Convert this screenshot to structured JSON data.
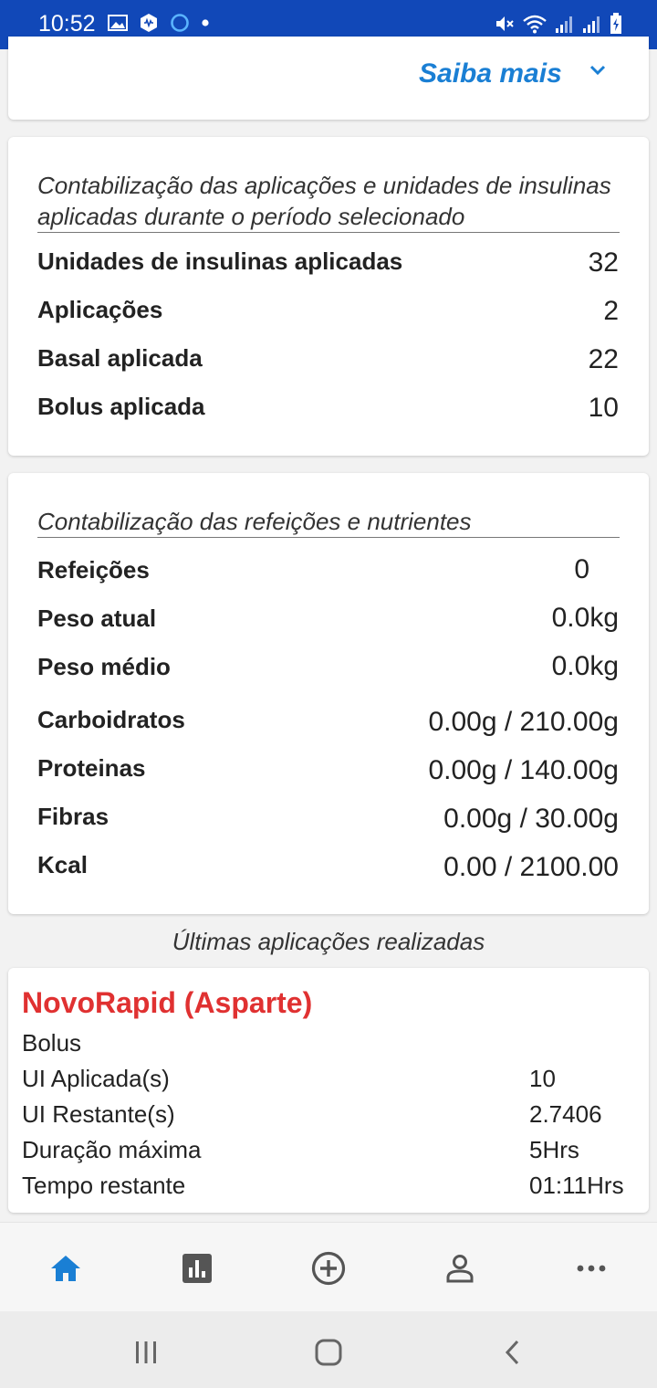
{
  "status_bar": {
    "time": "10:52",
    "left_icons": [
      "image-icon",
      "shield-icon",
      "circle-icon",
      "dot-icon"
    ],
    "right_icons": [
      "mute-icon",
      "wifi-icon",
      "signal-icon",
      "signal-icon",
      "battery-icon"
    ]
  },
  "saiba_card": {
    "label": "Saiba mais"
  },
  "insulin_card": {
    "title": "Contabilização das aplicações e unidades de insulinas aplicadas durante o período selecionado",
    "rows": [
      {
        "label": "Unidades de insulinas aplicadas",
        "value": "32"
      },
      {
        "label": "Aplicações",
        "value": "2"
      },
      {
        "label": "Basal aplicada",
        "value": "22"
      },
      {
        "label": "Bolus aplicada",
        "value": "10"
      }
    ]
  },
  "meals_card": {
    "title": "Contabilização das refeições e nutrientes",
    "rows": [
      {
        "label": "Refeições",
        "value": "0"
      },
      {
        "label": "Peso atual",
        "value": "0.0kg"
      },
      {
        "label": "Peso médio",
        "value": "0.0kg"
      },
      {
        "label": "Carboidratos",
        "value": "0.00g / 210.00g"
      },
      {
        "label": "Proteinas",
        "value": "0.00g / 140.00g"
      },
      {
        "label": "Fibras",
        "value": "0.00g / 30.00g"
      },
      {
        "label": "Kcal",
        "value": "0.00 / 2100.00"
      }
    ]
  },
  "last_applications": {
    "heading": "Últimas aplicações realizadas",
    "item": {
      "name": "NovoRapid (Asparte)",
      "type": "Bolus",
      "rows": [
        {
          "label": "UI Aplicada(s)",
          "value": "10"
        },
        {
          "label": "UI Restante(s)",
          "value": "2.7406"
        },
        {
          "label": "Duração máxima",
          "value": "5Hrs"
        },
        {
          "label": "Tempo restante",
          "value": "01:11Hrs"
        }
      ]
    }
  },
  "bottom_nav": {
    "items": [
      "home-icon",
      "chart-icon",
      "add-circle-icon",
      "person-icon",
      "more-icon"
    ],
    "active_color": "#1a7fd4",
    "inactive_color": "#555555"
  },
  "colors": {
    "status_bar": "#1148b8",
    "accent": "#1a7fd4",
    "drug_name": "#e03131"
  }
}
